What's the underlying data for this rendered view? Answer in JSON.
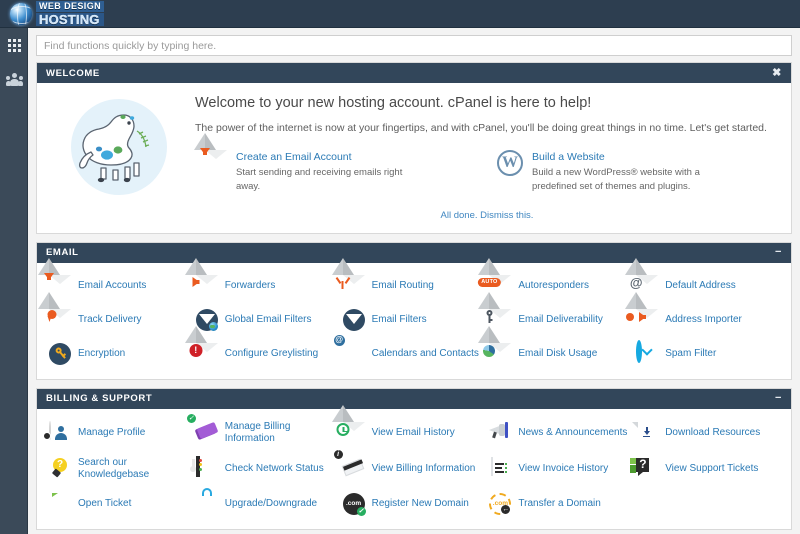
{
  "brand": {
    "line1": "WEB DESIGN",
    "line2": "HOSTING"
  },
  "rail": {
    "items": [
      {
        "name": "apps-grid",
        "icon": "grid-icon"
      },
      {
        "name": "user-manager",
        "icon": "people-icon"
      }
    ]
  },
  "search": {
    "placeholder": "Find functions quickly by typing here.",
    "value": ""
  },
  "welcome": {
    "panel_title": "WELCOME",
    "close_label": "✖",
    "heading": "Welcome to your new hosting account. cPanel is here to help!",
    "subheading": "The power of the internet is now at your fingertips, and with cPanel, you'll be doing great things in no time. Let's get started.",
    "promos": [
      {
        "icon": "envelope-download-icon",
        "title": "Create an Email Account",
        "desc": "Start sending and receiving emails right away."
      },
      {
        "icon": "wordpress-icon",
        "title": "Build a Website",
        "desc": "Build a new WordPress® website with a predefined set of themes and plugins."
      }
    ],
    "dismiss": "All done. Dismiss this."
  },
  "email": {
    "panel_title": "EMAIL",
    "collapse_label": "−",
    "items": [
      {
        "label": "Email Accounts",
        "icon": "envelope-download-icon"
      },
      {
        "label": "Forwarders",
        "icon": "envelope-arrow-right-icon"
      },
      {
        "label": "Email Routing",
        "icon": "envelope-routing-icon"
      },
      {
        "label": "Autoresponders",
        "icon": "envelope-auto-icon"
      },
      {
        "label": "Default Address",
        "icon": "envelope-at-icon"
      },
      {
        "label": "Track Delivery",
        "icon": "envelope-pin-icon"
      },
      {
        "label": "Global Email Filters",
        "icon": "funnel-globe-icon"
      },
      {
        "label": "Email Filters",
        "icon": "funnel-icon"
      },
      {
        "label": "Email Deliverability",
        "icon": "envelope-key-icon"
      },
      {
        "label": "Address Importer",
        "icon": "envelope-import-icon"
      },
      {
        "label": "Encryption",
        "icon": "key-lock-icon"
      },
      {
        "label": "Configure Greylisting",
        "icon": "envelope-alert-icon"
      },
      {
        "label": "Calendars and Contacts",
        "icon": "calendar-at-icon"
      },
      {
        "label": "Email Disk Usage",
        "icon": "envelope-pie-icon"
      },
      {
        "label": "Spam Filter",
        "icon": "spam-shield-icon"
      }
    ]
  },
  "billing": {
    "panel_title": "BILLING & SUPPORT",
    "collapse_label": "−",
    "items": [
      {
        "label": "Manage Profile",
        "icon": "person-gear-icon"
      },
      {
        "label": "Manage Billing Information",
        "icon": "credit-cards-check-icon"
      },
      {
        "label": "View Email History",
        "icon": "envelope-clock-icon"
      },
      {
        "label": "News & Announcements",
        "icon": "megaphone-icon"
      },
      {
        "label": "Download Resources",
        "icon": "document-download-icon"
      },
      {
        "label": "Search our Knowledgebase",
        "icon": "lightbulb-question-icon"
      },
      {
        "label": "Check Network Status",
        "icon": "network-status-icon"
      },
      {
        "label": "View Billing Information",
        "icon": "card-info-icon"
      },
      {
        "label": "View Invoice History",
        "icon": "invoice-icon"
      },
      {
        "label": "View Support Tickets",
        "icon": "question-bubble-icon"
      },
      {
        "label": "Open Ticket",
        "icon": "ticket-compose-icon"
      },
      {
        "label": "Upgrade/Downgrade",
        "icon": "shopping-bag-gear-icon"
      },
      {
        "label": "Register New Domain",
        "icon": "dotcom-check-icon"
      },
      {
        "label": "Transfer a Domain",
        "icon": "dotcom-transfer-icon"
      }
    ]
  },
  "colors": {
    "topbar": "#2d3e50",
    "rail": "#3b4a59",
    "panel_header": "#32465a",
    "link": "#2b7ab5",
    "accent_orange": "#ea5b20",
    "page_bg": "#f3f3f3"
  }
}
